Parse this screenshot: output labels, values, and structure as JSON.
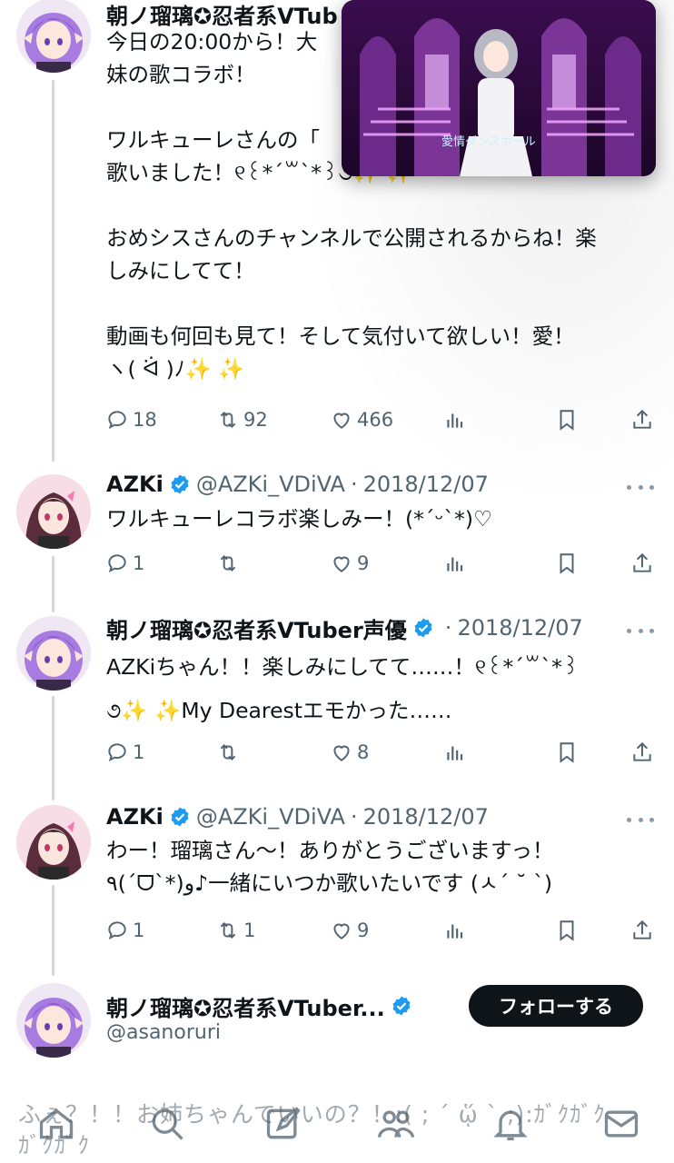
{
  "tweets": [
    {
      "name": "朝ノ瑠璃✪忍者系VTub",
      "lines": [
        "今日の20:00から！大",
        "妹の歌コラボ！",
        "",
        "ワルキューレさんの「",
        "歌いました！୧꒰*´꒳`*꒱૭✨ ✨",
        "",
        "おめシスさんのチャンネルで公開されるからね！楽",
        "しみにしてて！",
        "",
        "動画も何回も見て！そして気付いて欲しい！愛！",
        "ヽ( ᐛ )ﾉ✨ ✨"
      ],
      "replies": "18",
      "retweets": "92",
      "likes": "466"
    },
    {
      "name": "AZKi",
      "handle": "@AZKi_VDiVA",
      "sep": "·",
      "date": "2018/12/07",
      "lines": [
        "ワルキューレコラボ楽しみー！(*´ᵕ`*)♡"
      ],
      "replies": "1",
      "retweets": "",
      "likes": "9"
    },
    {
      "name": "朝ノ瑠璃✪忍者系VTuber声優",
      "sep": "·",
      "date": "2018/12/07",
      "lines": [
        "AZKiちゃん！！楽しみにしてて……！୧꒰*´꒳`*꒱",
        "૭✨ ✨My Dearestエモかった……"
      ],
      "replies": "1",
      "retweets": "",
      "likes": "8"
    },
    {
      "name": "AZKi",
      "handle": "@AZKi_VDiVA",
      "sep": "·",
      "date": "2018/12/07",
      "lines": [
        "わー！瑠璃さん〜！ありがとうございますっ！",
        "٩(´ᗜ`*)و♪一緒にいつか歌いたいです (ㅅ´ ˘ `)"
      ],
      "replies": "1",
      "retweets": "1",
      "likes": "9"
    }
  ],
  "profile": {
    "name": "朝ノ瑠璃✪忍者系VTuber...",
    "handle": "@asanoruri",
    "follow_label": "フォローする"
  },
  "overlay": {
    "line1": "ふぇ？！！お姉ちゃんでいいの？！:( ; ´ ᾥ ` ;):ｶﾞｸｶﾞｸ",
    "line2": "ｶﾞｸｶﾞｸ"
  },
  "video": {
    "caption": "愛情ダンスホール"
  },
  "icons": {
    "reply": "reply-icon",
    "retweet": "retweet-icon",
    "like": "heart-icon",
    "views": "views-icon",
    "bookmark": "bookmark-icon",
    "share": "share-icon",
    "verified": "verified-badge-icon",
    "more": "more-icon",
    "nav": [
      "home-icon",
      "search-icon",
      "compose-icon",
      "communities-icon",
      "notifications-icon",
      "messages-icon"
    ]
  },
  "colors": {
    "verified": "#1d9bf0",
    "text": "#0f1419",
    "muted": "#536471",
    "button": "#0f1419"
  }
}
